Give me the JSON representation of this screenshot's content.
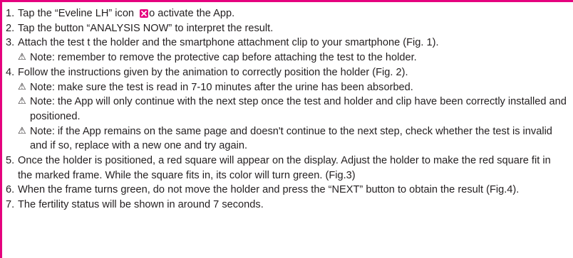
{
  "steps": [
    {
      "number": "1.",
      "text_before_icon": "Tap the “Eveline LH” icon ",
      "icon": "eveline-app-icon",
      "text_after_icon": "o activate the App."
    },
    {
      "number": "2.",
      "text": "Tap the button “ANALYSIS NOW” to interpret the result."
    },
    {
      "number": "3.",
      "text": "Attach the test t the holder and the smartphone attachment clip to your smartphone (Fig. 1).",
      "notes": [
        "Note: remember to remove the protective cap before attaching the test to the holder."
      ]
    },
    {
      "number": "4.",
      "text": "Follow the instructions given by the animation to correctly position the holder (Fig. 2).",
      "notes": [
        "Note: make sure the test is read in 7-10 minutes after the urine has been absorbed.",
        "Note: the App will only continue with the next step once the test and holder and clip have been correctly installed and positioned.",
        "Note: if the App remains on the same page and doesn't continue to the next step, check whether the test is invalid and if so, replace with a new one and try again."
      ]
    },
    {
      "number": "5.",
      "text": "Once the holder is positioned, a red square will appear on the display. Adjust the holder to make the red square fit in the marked frame. While the square fits in, its color will turn green. (Fig.3)"
    },
    {
      "number": "6.",
      "text": "When the frame turns green, do not move the holder and press the “NEXT” button to obtain the result (Fig.4)."
    },
    {
      "number": "7.",
      "text": "The fertility status will be shown in around 7 seconds."
    }
  ],
  "note_symbol": "⚠",
  "colors": {
    "accent": "#e5007e",
    "text": "#231f20"
  }
}
